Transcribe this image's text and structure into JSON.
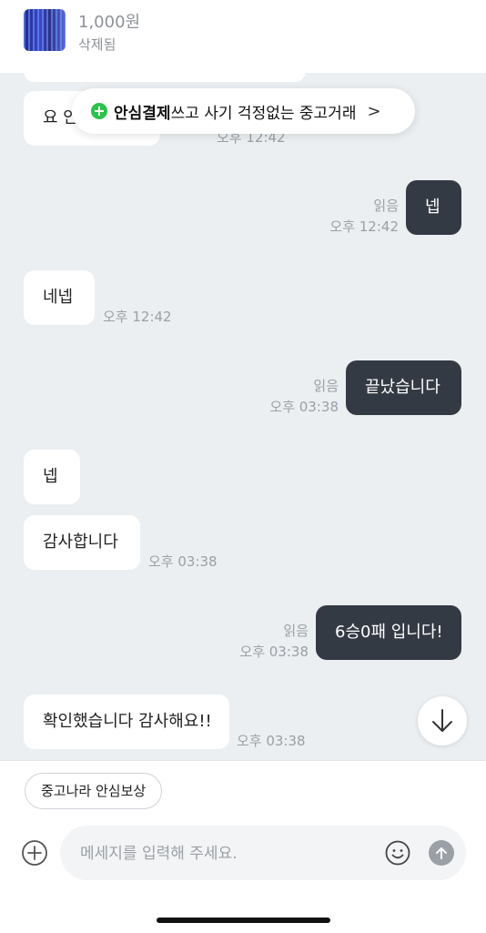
{
  "product": {
    "price": "1,000원",
    "status": "삭제됨"
  },
  "banner": {
    "bold": "안심결제",
    "text": "쓰고 사기 걱정없는 중고거래",
    "chevron": "chevron-right-icon"
  },
  "messages": {
    "m0": {
      "text": "요 안",
      "time": "오후 12:42"
    },
    "m1": {
      "text": "넵",
      "read": "읽음",
      "time": "오후 12:42"
    },
    "m2": {
      "text": "네넵",
      "time": "오후 12:42"
    },
    "m3": {
      "text": "끝났습니다",
      "read": "읽음",
      "time": "오후 03:38"
    },
    "m4": {
      "text": "넵"
    },
    "m5": {
      "text": "감사합니다",
      "time": "오후 03:38"
    },
    "m6": {
      "text": "6승0패 입니다!",
      "read": "읽음",
      "time": "오후 03:38"
    },
    "m7": {
      "text": "확인했습니다 감사해요!!",
      "time": "오후 03:38"
    }
  },
  "bottom": {
    "chip_label": "중고나라 안심보상",
    "input_placeholder": "메세지를 입력해 주세요.",
    "input_value": ""
  },
  "icons": {
    "attach": "plus-circle-icon",
    "emoji": "smiley-icon",
    "send": "arrow-up-icon",
    "scroll": "arrow-down-icon"
  },
  "colors": {
    "chat_background": "#eceff1",
    "outgoing_bubble": "#343a44",
    "incoming_bubble": "#ffffff",
    "accent_green": "#2cc24c"
  }
}
